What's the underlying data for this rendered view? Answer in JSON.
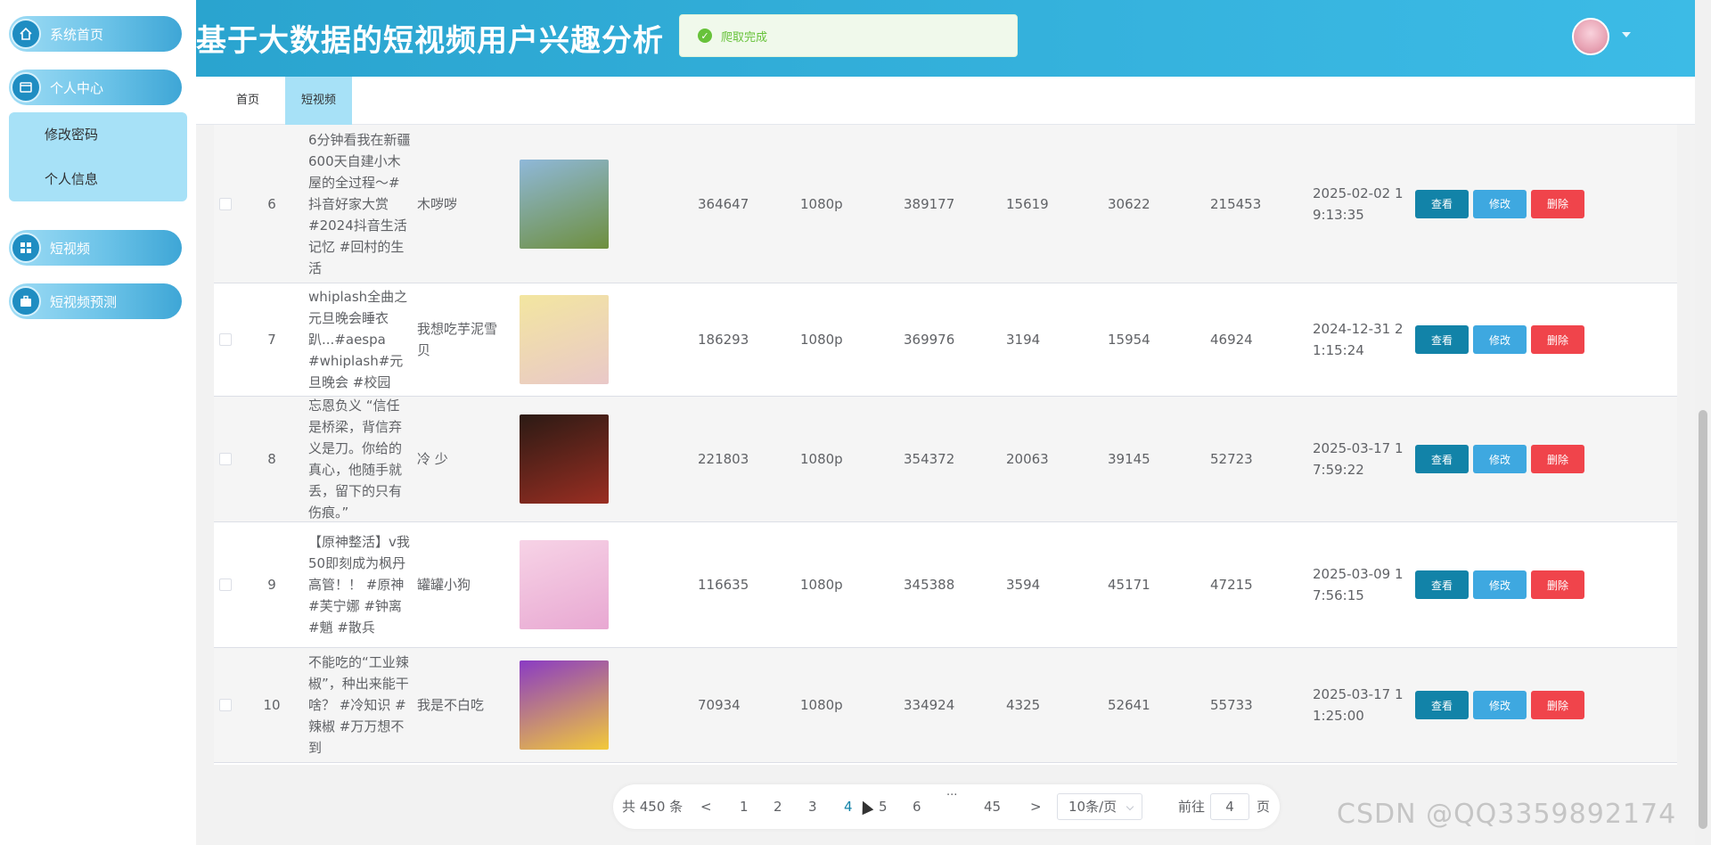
{
  "app": {
    "title": "基于大数据的短视频用户兴趣分析",
    "toast": "爬取完成"
  },
  "sidebar": {
    "home": "系统首页",
    "personal": "个人中心",
    "sub": [
      "修改密码",
      "个人信息"
    ],
    "video": "短视频",
    "predict": "短视频预测"
  },
  "tabs": [
    "首页",
    "短视频"
  ],
  "buttons": {
    "view": "查看",
    "edit": "修改",
    "delete": "删除"
  },
  "rows": [
    {
      "idx": "6",
      "title": "6分钟看我在新疆600天自建小木屋的全过程～#抖音好家大赏 #2024抖音生活记忆 #回村的生活",
      "author": "木哕哕",
      "c1": "364647",
      "res": "1080p",
      "c2": "389177",
      "c3": "15619",
      "c4": "30622",
      "c5": "215453",
      "time": "2025-02-02 19:13:35",
      "thumb_colors": [
        "#8fb8d9",
        "#6e8f3e"
      ]
    },
    {
      "idx": "7",
      "title": "whiplash全曲之元旦晚会睡衣趴...#aespa #whiplash#元旦晚会 #校园",
      "author": "我想吃芋泥雪贝",
      "c1": "186293",
      "res": "1080p",
      "c2": "369976",
      "c3": "3194",
      "c4": "15954",
      "c5": "46924",
      "time": "2024-12-31 21:15:24",
      "thumb_colors": [
        "#f3e6a0",
        "#e9c8c8"
      ]
    },
    {
      "idx": "8",
      "title": "忘恩负义 “信任是桥梁，背信弃义是刀。你给的真心，他随手就丢，留下的只有伤痕。”",
      "author": "冷 少",
      "c1": "221803",
      "res": "1080p",
      "c2": "354372",
      "c3": "20063",
      "c4": "39145",
      "c5": "52723",
      "time": "2025-03-17 17:59:22",
      "thumb_colors": [
        "#2b1a14",
        "#9a2e22"
      ]
    },
    {
      "idx": "9",
      "title": "【原神整活】v我50即刻成为枫丹高管！！ #原神 #芙宁娜 #钟离 #魈 #散兵",
      "author": "罐罐小狗",
      "c1": "116635",
      "res": "1080p",
      "c2": "345388",
      "c3": "3594",
      "c4": "45171",
      "c5": "47215",
      "time": "2025-03-09 17:56:15",
      "thumb_colors": [
        "#f7d3e6",
        "#e8a8d2"
      ]
    },
    {
      "idx": "10",
      "title": "不能吃的“工业辣椒”，种出来能干啥？ #冷知识 #辣椒 #万万想不到",
      "author": "我是不白吃",
      "c1": "70934",
      "res": "1080p",
      "c2": "334924",
      "c3": "4325",
      "c4": "52641",
      "c5": "55733",
      "time": "2025-03-17 11:25:00",
      "thumb_colors": [
        "#8a3bc4",
        "#f2c93a"
      ]
    }
  ],
  "pager": {
    "total": "共 450 条",
    "prev": "<",
    "pages": [
      "1",
      "2",
      "3",
      "4",
      "5",
      "6"
    ],
    "ellipsis": "···",
    "last": "45",
    "next": ">",
    "size": "10条/页",
    "goto": "前往",
    "goto_value": "4",
    "unit": "页",
    "current": "4"
  },
  "watermark": "CSDN @QQ3359892174"
}
